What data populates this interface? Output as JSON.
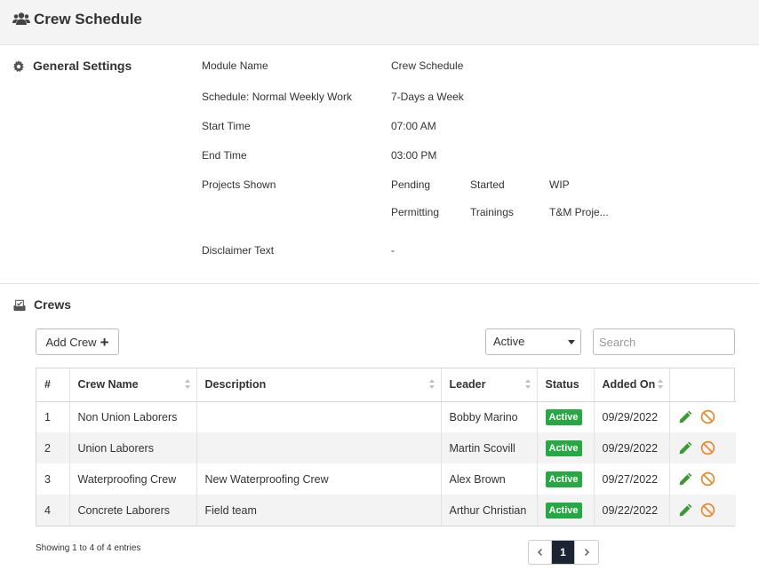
{
  "header": {
    "title": "Crew Schedule",
    "icon": "users-icon"
  },
  "general_settings": {
    "title": "General Settings",
    "icon": "gear-icon",
    "rows": [
      {
        "label": "Module Name",
        "value": "Crew Schedule"
      },
      {
        "label": "Schedule: Normal Weekly Work",
        "value": "7-Days a Week"
      },
      {
        "label": "Start Time",
        "value": "07:00 AM"
      },
      {
        "label": "End Time",
        "value": "03:00 PM"
      }
    ],
    "projects_shown_label": "Projects Shown",
    "projects_shown": [
      "Pending",
      "Started",
      "WIP",
      "Permitting",
      "Trainings",
      "T&M Proje..."
    ],
    "disclaimer_label": "Disclaimer Text",
    "disclaimer_value": "-"
  },
  "crews": {
    "title": "Crews",
    "icon": "inbox-check-icon",
    "add_button_label": "Add Crew",
    "status_filter": "Active",
    "search_placeholder": "Search",
    "columns": [
      "#",
      "Crew Name",
      "Description",
      "Leader",
      "Status",
      "Added On",
      ""
    ],
    "rows": [
      {
        "num": "1",
        "name": "Non Union Laborers",
        "description": "",
        "leader": "Bobby Marino",
        "status": "Active",
        "added_on": "09/29/2022"
      },
      {
        "num": "2",
        "name": "Union Laborers",
        "description": "",
        "leader": "Martin Scovill",
        "status": "Active",
        "added_on": "09/29/2022"
      },
      {
        "num": "3",
        "name": "Waterproofing Crew",
        "description": "New Waterproofing Crew",
        "leader": "Alex Brown",
        "status": "Active",
        "added_on": "09/27/2022"
      },
      {
        "num": "4",
        "name": "Concrete Laborers",
        "description": "Field team",
        "leader": "Arthur Christian",
        "status": "Active",
        "added_on": "09/22/2022"
      }
    ],
    "footer_info": "Showing 1 to 4 of 4 entries",
    "current_page": "1"
  },
  "colors": {
    "active_badge": "#28a745",
    "edit_icon": "#3c9a35",
    "disable_icon": "#e8892b",
    "pager_active": "#1a2432"
  }
}
